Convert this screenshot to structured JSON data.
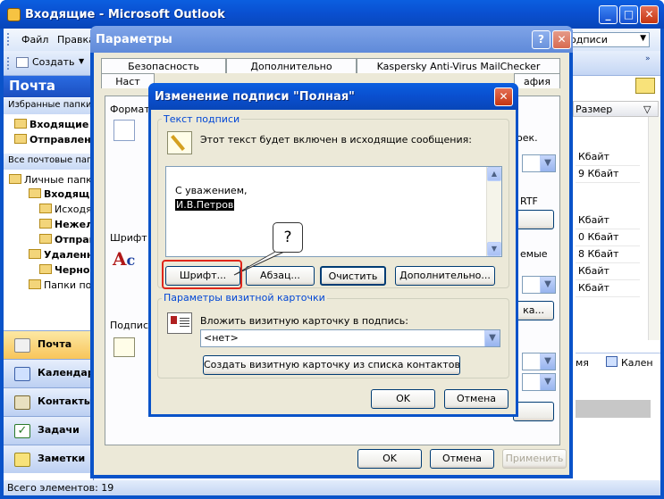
{
  "outlook": {
    "title": "Входящие - Microsoft Outlook",
    "menu": [
      "Файл",
      "Правка"
    ],
    "search_value": "одписи",
    "toolbar_create": "Создать",
    "nav_header": "Почта",
    "favorites_header": "Избранные папки",
    "favorites": [
      "Входящие",
      "Отправленные"
    ],
    "all_mail_header": "Все почтовые папки",
    "tree": [
      "Личные папки",
      "Входящие",
      "Исходящие",
      "Нежелательная",
      "Отправленные",
      "Удаленные",
      "Черновики",
      "Папки поиска"
    ],
    "pane_buttons": [
      "Почта",
      "Календарь",
      "Контакты",
      "Задачи",
      "Заметки"
    ],
    "column_header": "Размер",
    "sizes": [
      "Кбайт",
      "9 Кбайт",
      "Кбайт",
      "0 Кбайт",
      "8 Кбайт",
      "Кбайт",
      "Кбайт"
    ],
    "reading_pane": [
      "мя",
      "Кален"
    ],
    "status": "Всего элементов: 19"
  },
  "params": {
    "title": "Параметры",
    "tabs_back": [
      "Безопасность",
      "Дополнительно",
      "Kaspersky Anti-Virus MailChecker"
    ],
    "tabs_front": [
      "Наст",
      "афия"
    ],
    "sections": [
      "Формат с",
      "Шрифт",
      "Подписи"
    ],
    "frag_right": [
      "оек.",
      "RTF",
      "емые",
      "ка..."
    ],
    "ok": "OK",
    "cancel": "Отмена",
    "apply": "Применить"
  },
  "sig": {
    "title": "Изменение подписи \"Полная\"",
    "group_text": "Текст подписи",
    "description": "Этот текст будет включен в исходящие сообщения:",
    "line1": "С уважением,",
    "line2": "И.В.Петров",
    "btn_font": "Шрифт...",
    "btn_para": "Абзац...",
    "btn_clear": "Очистить",
    "btn_more": "Дополнительно...",
    "group_vcard": "Параметры визитной карточки",
    "vcard_label": "Вложить визитную карточку в подпись:",
    "vcard_value": "<нет>",
    "btn_create_vcard": "Создать визитную карточку из списка контактов...",
    "ok": "OK",
    "cancel": "Отмена",
    "callout": "?"
  },
  "colors": {
    "xp_blue": "#0a53c9",
    "highlight": "#e0261a",
    "selection": "#000000"
  }
}
